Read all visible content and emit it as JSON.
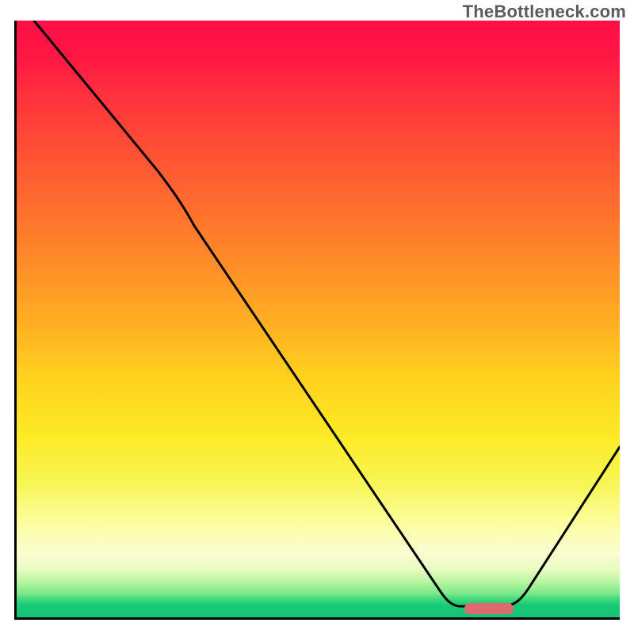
{
  "watermark": "TheBottleneck.com",
  "marker_style": "left:565px; width:62px; bottom:4px;",
  "colors": {
    "top": "#ff0f46",
    "mid": "#ffd21e",
    "bottom": "#14c373",
    "marker": "#de6a6f",
    "axis": "#000000"
  },
  "chart_data": {
    "type": "line",
    "title": "",
    "xlabel": "",
    "ylabel": "",
    "xlim": [
      0,
      100
    ],
    "ylim": [
      0,
      100
    ],
    "x": [
      3,
      24,
      30,
      70,
      73,
      81,
      85,
      100
    ],
    "values": [
      100,
      74,
      66,
      4,
      2,
      2,
      5,
      29
    ],
    "optimal_range_x": [
      74,
      82
    ],
    "annotations": [
      "TheBottleneck.com"
    ]
  }
}
